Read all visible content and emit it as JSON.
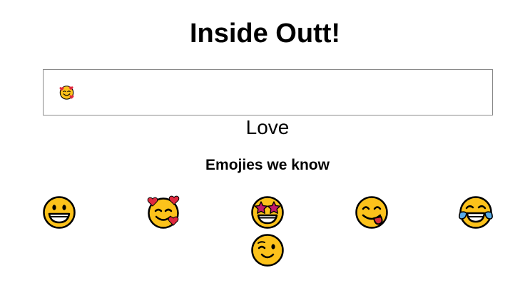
{
  "header": {
    "title": "Inside Outt!"
  },
  "input": {
    "value_emoji": "smiling-face-with-hearts"
  },
  "meaning": {
    "text": "Love"
  },
  "known_emojis": {
    "heading": "Emojies we know",
    "items": [
      {
        "icon": "grinning-face"
      },
      {
        "icon": "smiling-face-with-hearts"
      },
      {
        "icon": "star-struck"
      },
      {
        "icon": "face-savoring-food"
      },
      {
        "icon": "face-with-tears-of-joy"
      },
      {
        "icon": "winking-face"
      }
    ]
  },
  "colors": {
    "face": "#FCC21B",
    "outline": "#000000",
    "heart": "#E0293F",
    "star": "#C2186A",
    "tongue": "#D9303E",
    "tear": "#58ACE8",
    "input_border": "#8A8A8A"
  }
}
